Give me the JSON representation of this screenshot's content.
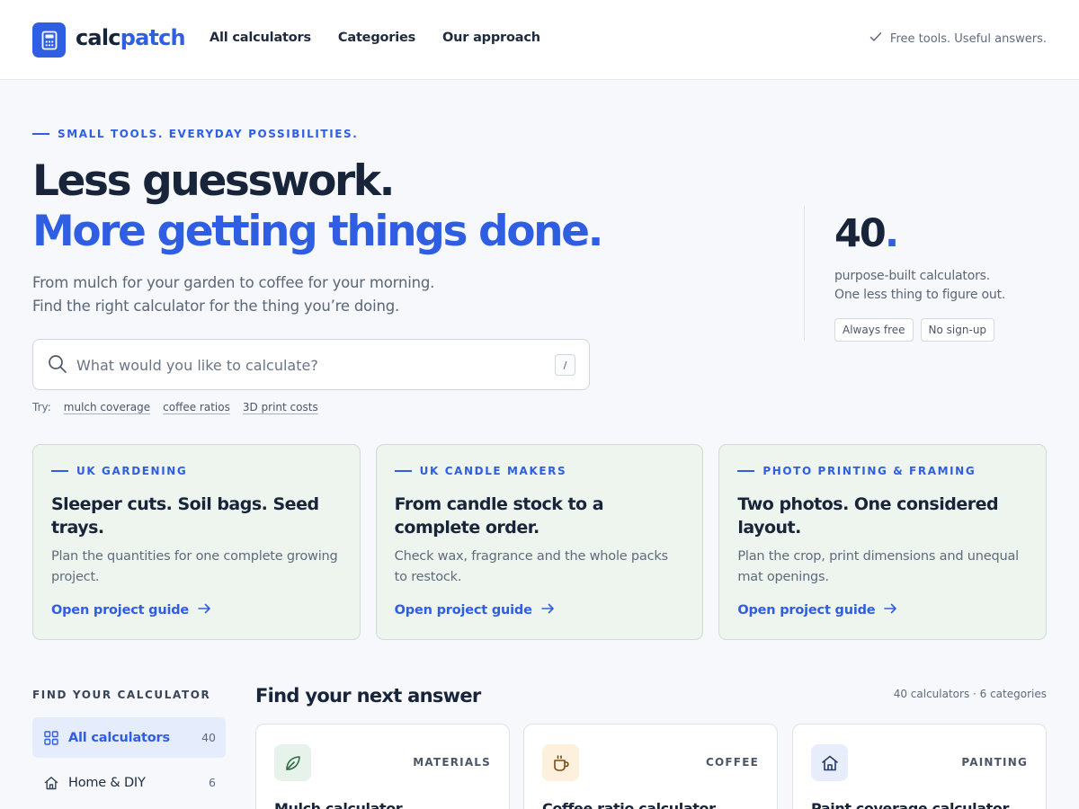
{
  "header": {
    "logo_icon": "calculator-icon",
    "logo_prefix": "calc",
    "logo_suffix": "patch",
    "nav": [
      "All calculators",
      "Categories",
      "Our approach"
    ],
    "tagline_icon": "check-icon",
    "tagline": "Free tools. Useful answers."
  },
  "hero": {
    "eyebrow": "SMALL TOOLS. EVERYDAY POSSIBILITIES.",
    "title_line1": "Less guesswork.",
    "title_line2": "More getting things done.",
    "subtitle_line1": "From mulch for your garden to coffee for your morning.",
    "subtitle_line2": "Find the right calculator for the thing you’re doing.",
    "search": {
      "icon": "search-icon",
      "placeholder": "What would you like to calculate?",
      "value": "",
      "shortcut": "/"
    },
    "try_label": "Try:",
    "try_links": [
      "mulch coverage",
      "coffee ratios",
      "3D print costs"
    ]
  },
  "stat": {
    "number": "40",
    "dot": ".",
    "desc_line1": "purpose-built calculators.",
    "desc_line2": "One less thing to figure out.",
    "badges": [
      "Always free",
      "No sign-up"
    ]
  },
  "guides": [
    {
      "eyebrow": "UK GARDENING",
      "title": "Sleeper cuts. Soil bags. Seed trays.",
      "desc": "Plan the quantities for one complete growing project.",
      "link": "Open project guide"
    },
    {
      "eyebrow": "UK CANDLE MAKERS",
      "title": "From candle stock to a complete order.",
      "desc": "Check wax, fragrance and the whole packs to restock.",
      "link": "Open project guide"
    },
    {
      "eyebrow": "PHOTO PRINTING & FRAMING",
      "title": "Two photos. One considered layout.",
      "desc": "Plan the crop, print dimensions and unequal mat openings.",
      "link": "Open project guide"
    }
  ],
  "sidebar": {
    "title": "FIND YOUR CALCULATOR",
    "items": [
      {
        "label": "All calculators",
        "count": "40",
        "icon": "grid-icon",
        "active": true
      },
      {
        "label": "Home & DIY",
        "count": "6",
        "icon": "home-icon",
        "active": false
      }
    ]
  },
  "results": {
    "title": "Find your next answer",
    "meta": "40 calculators · 6 categories",
    "cards": [
      {
        "category": "MATERIALS",
        "name": "Mulch calculator",
        "icon": "leaf-icon",
        "icon_bg": "#e7f3ea",
        "icon_color": "#2d6b47"
      },
      {
        "category": "COFFEE",
        "name": "Coffee ratio calculator",
        "icon": "coffee-cup-icon",
        "icon_bg": "#fdf0dd",
        "icon_color": "#7a4a12"
      },
      {
        "category": "PAINTING",
        "name": "Paint coverage calculator",
        "icon": "house-icon",
        "icon_bg": "#e8edfb",
        "icon_color": "#2b3a66"
      }
    ]
  },
  "colors": {
    "accent": "#2f5ee3",
    "text": "#17243a",
    "muted": "#5f6b7c",
    "guide_bg": "#eef4ee"
  }
}
